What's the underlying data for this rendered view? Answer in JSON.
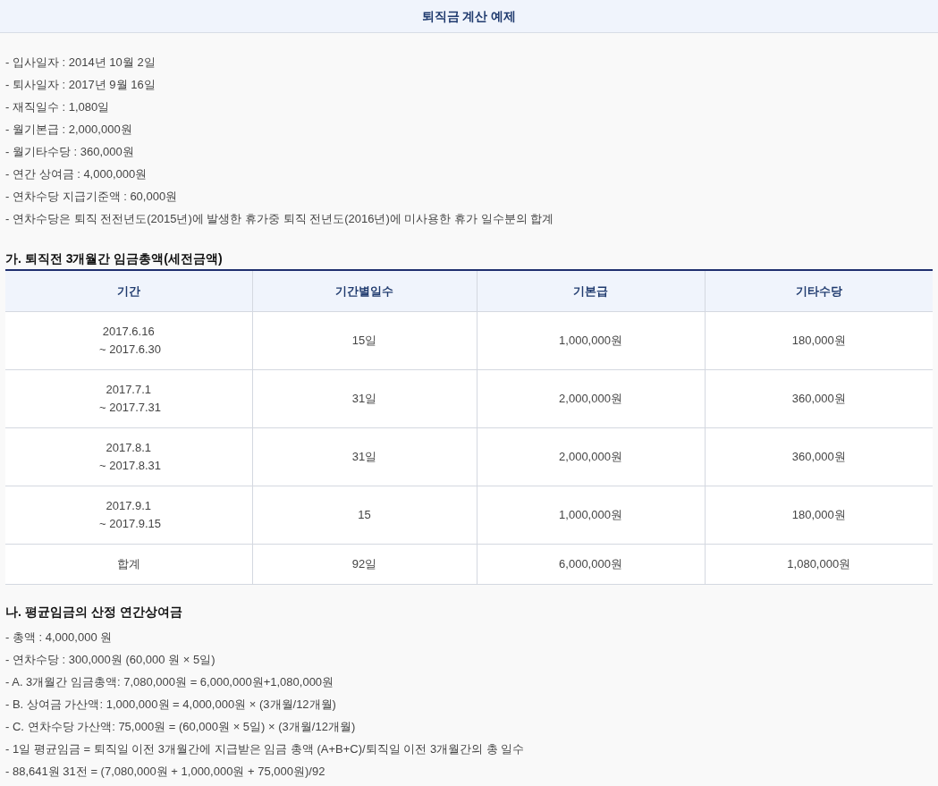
{
  "header": {
    "title": "퇴직금 계산 예제"
  },
  "facts": [
    "- 입사일자 : 2014년 10월 2일",
    "- 퇴사일자 : 2017년 9월 16일",
    "- 재직일수 : 1,080일",
    "- 월기본급 : 2,000,000원",
    "- 월기타수당 : 360,000원",
    "- 연간 상여금 : 4,000,000원",
    "- 연차수당 지급기준액 : 60,000원",
    "- 연차수당은 퇴직 전전년도(2015년)에 발생한 휴가중 퇴직 전년도(2016년)에 미사용한 휴가 일수분의 합계"
  ],
  "section_a": {
    "title": "가. 퇴직전 3개월간 임금총액(세전금액)",
    "table": {
      "columns": [
        "기간",
        "기간별일수",
        "기본급",
        "기타수당"
      ],
      "rows": [
        {
          "cells": [
            "2017.6.16\n ~ 2017.6.30",
            "15일",
            "1,000,000원",
            "180,000원"
          ]
        },
        {
          "cells": [
            "2017.7.1\n ~ 2017.7.31",
            "31일",
            "2,000,000원",
            "360,000원"
          ]
        },
        {
          "cells": [
            "2017.8.1\n ~ 2017.8.31",
            "31일",
            "2,000,000원",
            "360,000원"
          ]
        },
        {
          "cells": [
            "2017.9.1\n ~ 2017.9.15",
            "15",
            "1,000,000원",
            "180,000원"
          ]
        },
        {
          "cells": [
            "합계",
            "92일",
            "6,000,000원",
            "1,080,000원"
          ]
        }
      ]
    }
  },
  "section_b": {
    "title": "나. 평균임금의 산정 연간상여금",
    "lines": [
      "- 총액 : 4,000,000 원",
      "- 연차수당 : 300,000원 (60,000 원 × 5일)",
      "- A. 3개월간 임금총액: 7,080,000원 = 6,000,000원+1,080,000원",
      "- B. 상여금 가산액: 1,000,000원 = 4,000,000원 × (3개월/12개월)",
      "- C. 연차수당 가산액: 75,000원 = (60,000원 × 5일) × (3개월/12개월)",
      "- 1일 평균임금 = 퇴직일 이전 3개월간에 지급받은 임금 총액 (A+B+C)/퇴직일 이전 3개월간의 총 일수",
      "- 88,641원 31전 = (7,080,000원 + 1,000,000원 + 75,000원)/92"
    ]
  }
}
